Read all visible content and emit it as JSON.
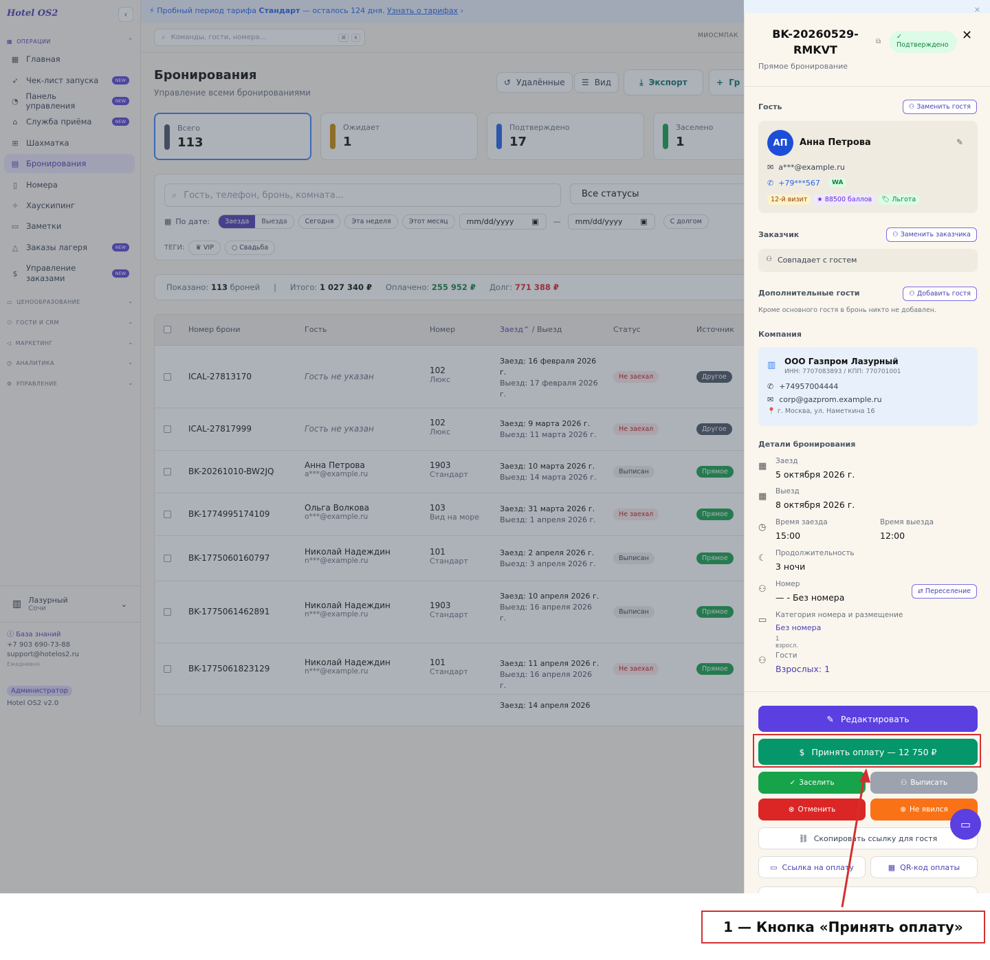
{
  "app": {
    "logo": "Hotel OS2"
  },
  "banner": {
    "prefix": "Пробный период тарифа",
    "plan": "Стандарт",
    "suffix": "— осталось 124 дня.",
    "link": "Узнать о тарифах"
  },
  "topbar": {
    "search_placeholder": "Команды, гости, номера...",
    "kbd1": "⌘",
    "kbd2": "K",
    "user_initials": "МИОСМПАК"
  },
  "sidebar": {
    "section_ops": "ОПЕРАЦИИ",
    "items": [
      {
        "label": "Главная",
        "icon": "grid-icon",
        "new": false
      },
      {
        "label": "Чек-лист запуска",
        "icon": "rocket-icon",
        "new": true
      },
      {
        "label": "Панель управления",
        "icon": "gauge-icon",
        "new": true
      },
      {
        "label": "Служба приёма",
        "icon": "bell-icon",
        "new": true
      },
      {
        "label": "Шахматка",
        "icon": "table-icon",
        "new": false
      },
      {
        "label": "Бронирования",
        "icon": "clipboard-icon",
        "new": false
      },
      {
        "label": "Номера",
        "icon": "door-icon",
        "new": false
      },
      {
        "label": "Хаускипинг",
        "icon": "sparkle-icon",
        "new": false
      },
      {
        "label": "Заметки",
        "icon": "note-icon",
        "new": false
      },
      {
        "label": "Заказы лагеря",
        "icon": "tent-icon",
        "new": true
      },
      {
        "label": "Управление заказами",
        "icon": "dollar-icon",
        "new": true
      }
    ],
    "new_badge": "NEW",
    "sections": [
      "ЦЕНООБРАЗОВАНИЕ",
      "ГОСТИ И CRM",
      "МАРКЕТИНГ",
      "АНАЛИТИКА",
      "УПРАВЛЕНИЕ"
    ],
    "hotel_name": "Лазурный",
    "hotel_city": "Сочи",
    "kb": "База знаний",
    "phone": "+7 903 690-73-88",
    "email": "support@hotelos2.ru",
    "daily": "Ежедневно",
    "role": "Администратор",
    "version": "Hotel OS2 v2.0"
  },
  "page": {
    "title": "Бронирования",
    "subtitle": "Управление всеми бронированиями",
    "btn_deleted": "Удалённые",
    "btn_view": "Вид",
    "btn_export": "Экспорт",
    "btn_group": "Гр"
  },
  "stats": [
    {
      "label": "Всего",
      "value": "113",
      "color": "#4b5563"
    },
    {
      "label": "Ожидает",
      "value": "1",
      "color": "#ca8a04"
    },
    {
      "label": "Подтверждено",
      "value": "17",
      "color": "#2563eb"
    },
    {
      "label": "Заселено",
      "value": "1",
      "color": "#16a34a"
    }
  ],
  "filters": {
    "search_placeholder": "Гость, телефон, бронь, комната...",
    "status": "Все статусы",
    "by_date": "По дате:",
    "arrival": "Заезда",
    "departure": "Выезда",
    "today": "Сегодня",
    "week": "Эта неделя",
    "month": "Этот месяц",
    "date_ph": "mm/dd/yyyy",
    "dash": "—",
    "with_debt": "С долгом",
    "tags_label": "ТЕГИ:",
    "tag1": "VIP",
    "tag2": "Свадьба"
  },
  "totals": {
    "shown_label": "Показано:",
    "shown": "113",
    "shown_suffix": "броней",
    "total_label": "Итого:",
    "total": "1 027 340 ₽",
    "paid_label": "Оплачено:",
    "paid": "255 952 ₽",
    "debt_label": "Долг:",
    "debt": "771 388 ₽"
  },
  "table": {
    "headers": {
      "id": "Номер брони",
      "guest": "Гость",
      "room": "Номер",
      "arr": "Заезд",
      "sep": "/",
      "dep": "Выезд",
      "status": "Статус",
      "source": "Источник"
    },
    "rows": [
      {
        "id": "ICAL-27813170",
        "guest": "Гость не указан",
        "email": "",
        "room": "102",
        "type": "Люкс",
        "arr": "Заезд: 16 февраля 2026 г.",
        "dep": "Выезд: 17 февраля 2026 г.",
        "status": "Не заехал",
        "st": "no",
        "source": "Другое",
        "sr": "o"
      },
      {
        "id": "ICAL-27817999",
        "guest": "Гость не указан",
        "email": "",
        "room": "102",
        "type": "Люкс",
        "arr": "Заезд: 9 марта 2026 г.",
        "dep": "Выезд: 11 марта 2026 г.",
        "status": "Не заехал",
        "st": "no",
        "source": "Другое",
        "sr": "o"
      },
      {
        "id": "BK-20261010-BW2JQ",
        "guest": "Анна Петрова",
        "email": "a***@example.ru",
        "room": "1903",
        "type": "Стандарт",
        "arr": "Заезд: 10 марта 2026 г.",
        "dep": "Выезд: 14 марта 2026 г.",
        "status": "Выписан",
        "st": "out",
        "source": "Прямое",
        "sr": "d"
      },
      {
        "id": "BK-1774995174109",
        "guest": "Ольга Волкова",
        "email": "o***@example.ru",
        "room": "103",
        "type": "Вид на море",
        "arr": "Заезд: 31 марта 2026 г.",
        "dep": "Выезд: 1 апреля 2026 г.",
        "status": "Не заехал",
        "st": "no",
        "source": "Прямое",
        "sr": "d"
      },
      {
        "id": "BK-1775060160797",
        "guest": "Николай Надеждин",
        "email": "n***@example.ru",
        "room": "101",
        "type": "Стандарт",
        "arr": "Заезд: 2 апреля 2026 г.",
        "dep": "Выезд: 3 апреля 2026 г.",
        "status": "Выписан",
        "st": "out",
        "source": "Прямое",
        "sr": "d"
      },
      {
        "id": "BK-1775061462891",
        "guest": "Николай Надеждин",
        "email": "n***@example.ru",
        "room": "1903",
        "type": "Стандарт",
        "arr": "Заезд: 10 апреля 2026 г.",
        "dep": "Выезд: 16 апреля 2026 г.",
        "status": "Выписан",
        "st": "out",
        "source": "Прямое",
        "sr": "d"
      },
      {
        "id": "BK-1775061823129",
        "guest": "Николай Надеждин",
        "email": "n***@example.ru",
        "room": "101",
        "type": "Стандарт",
        "arr": "Заезд: 11 апреля 2026 г.",
        "dep": "Выезд: 16 апреля 2026 г.",
        "status": "Не заехал",
        "st": "no",
        "source": "Прямое",
        "sr": "d"
      },
      {
        "id": "",
        "guest": "",
        "email": "",
        "room": "",
        "type": "",
        "arr": "Заезд: 14 апреля 2026",
        "dep": "",
        "status": "",
        "st": "",
        "source": "",
        "sr": ""
      }
    ]
  },
  "panel": {
    "booking_id": "BK-20260529-RMKVT",
    "status": "Подтверждено",
    "subtitle": "Прямое бронирование",
    "guest_label": "Гость",
    "replace_guest": "Заменить гостя",
    "avatar": "АП",
    "guest_name": "Анна Петрова",
    "guest_email": "a***@example.ru",
    "guest_phone": "+79***567",
    "wa": "WA",
    "visit": "12-й визит",
    "points": "★ 88500 баллов",
    "benefit": "🏷 Льгота",
    "customer_label": "Заказчик",
    "replace_customer": "Заменить заказчика",
    "customer_same": "Совпадает с гостем",
    "extra_label": "Дополнительные гости",
    "add_guest": "Добавить гостя",
    "extra_note": "Кроме основного гостя в бронь никто не добавлен.",
    "company_label": "Компания",
    "company_name": "ООО Газпром Лазурный",
    "company_inn": "ИНН: 7707083893 / КПП: 770701001",
    "company_phone": "+74957004444",
    "company_email": "corp@gazprom.example.ru",
    "company_addr": "📍 г. Москва, ул. Наметкина 16",
    "details_label": "Детали бронирования",
    "checkin_label": "Заезд",
    "checkin": "5 октября 2026 г.",
    "checkout_label": "Выезд",
    "checkout": "8 октября 2026 г.",
    "checkin_time_label": "Время заезда",
    "checkin_time": "15:00",
    "checkout_time_label": "Время выезда",
    "checkout_time": "12:00",
    "duration_label": "Продолжительность",
    "duration": "3 ночи",
    "room_label": "Номер",
    "room": "— - Без номера",
    "relocate": "Переселение",
    "category_label": "Категория номера и размещение",
    "category": "Без номера",
    "occupancy": "1 взросл.",
    "guests_label": "Гости",
    "guests": "Взрослых: 1",
    "btn_edit": "Редактировать",
    "btn_pay": "Принять оплату — 12 750 ₽",
    "btn_checkin": "Заселить",
    "btn_checkout": "Выписать",
    "btn_cancel": "Отменить",
    "btn_noshow": "Не явился",
    "btn_copy_link": "Скопировать ссылку для гостя",
    "btn_pay_link": "Ссылка на оплату",
    "btn_qr": "QR-код оплаты"
  },
  "annotation": {
    "callout": "1 — Кнопка «Принять оплату»"
  },
  "colors": {
    "accent": "#5b3fe0",
    "pay": "#059669",
    "highlight": "#d32f2f"
  }
}
